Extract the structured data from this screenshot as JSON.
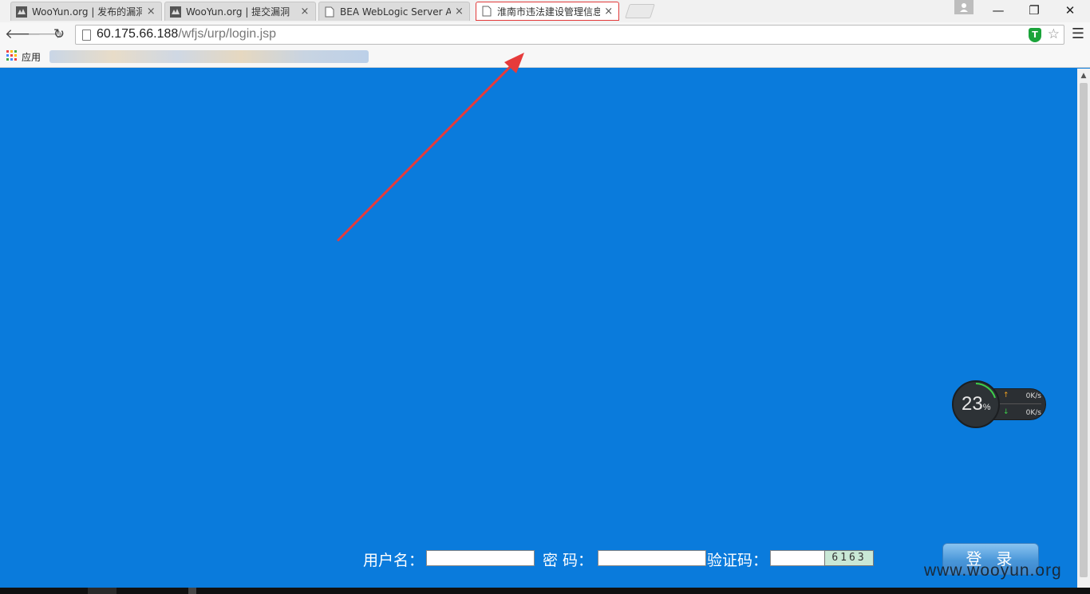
{
  "browser": {
    "tabs": [
      {
        "title": "WooYun.org | 发布的漏洞",
        "icon": "wooyun-favicon",
        "active": false
      },
      {
        "title": "WooYun.org | 提交漏洞",
        "icon": "wooyun-favicon",
        "active": false
      },
      {
        "title": "BEA WebLogic Server Ad",
        "icon": "page-icon",
        "active": false
      },
      {
        "title": "淮南市违法建设管理信息系",
        "icon": "page-icon",
        "active": true
      }
    ],
    "close_glyph": "×",
    "window_controls": {
      "minimize": "—",
      "restore": "❐",
      "close": "✕"
    },
    "url": {
      "host": "60.175.66.188",
      "path": "/wfjs/urp/login.jsp"
    },
    "bookmarks_bar": {
      "apps_label": "应用"
    }
  },
  "login_form": {
    "username_label": "用户名：",
    "password_label": "密  码：",
    "captcha_label": "验证码：",
    "captcha_value": "6163",
    "login_button": "登录"
  },
  "net_widget": {
    "percent": "23",
    "percent_unit": "%",
    "upload_rate": "0K/s",
    "download_rate": "0K/s"
  },
  "watermark": "www.wooyun.org",
  "colors": {
    "page_background": "#0a7bdc",
    "active_tab_border": "#e23b3b",
    "arrow": "#e63b3b"
  }
}
